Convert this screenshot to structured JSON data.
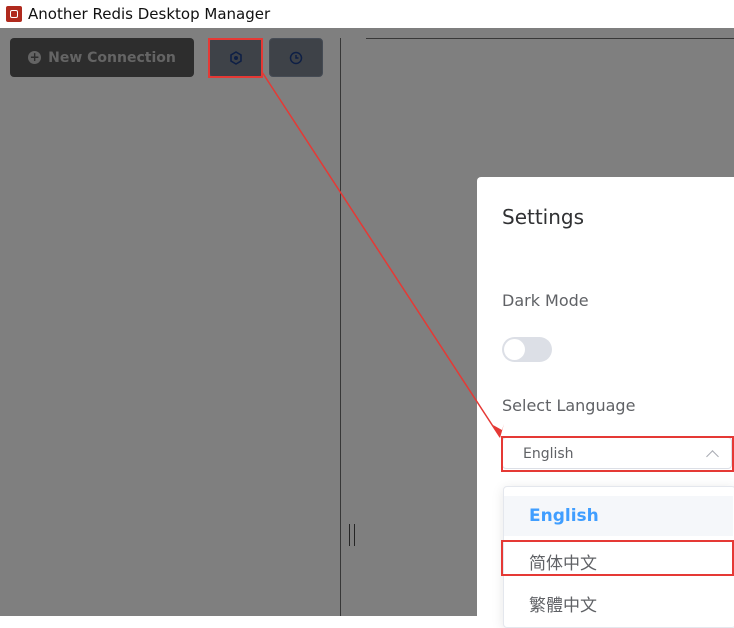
{
  "window": {
    "title": "Another Redis Desktop Manager"
  },
  "toolbar": {
    "new_connection_label": "New Connection",
    "settings_icon": "gear-icon",
    "history_icon": "clock-icon"
  },
  "settings_dialog": {
    "title": "Settings",
    "dark_mode_label": "Dark Mode",
    "dark_mode_enabled": false,
    "language_label": "Select Language",
    "selected_language": "English",
    "language_options": [
      "English",
      "简体中文",
      "繁體中文"
    ]
  },
  "colors": {
    "highlight": "#e53935",
    "accent": "#409eff"
  }
}
